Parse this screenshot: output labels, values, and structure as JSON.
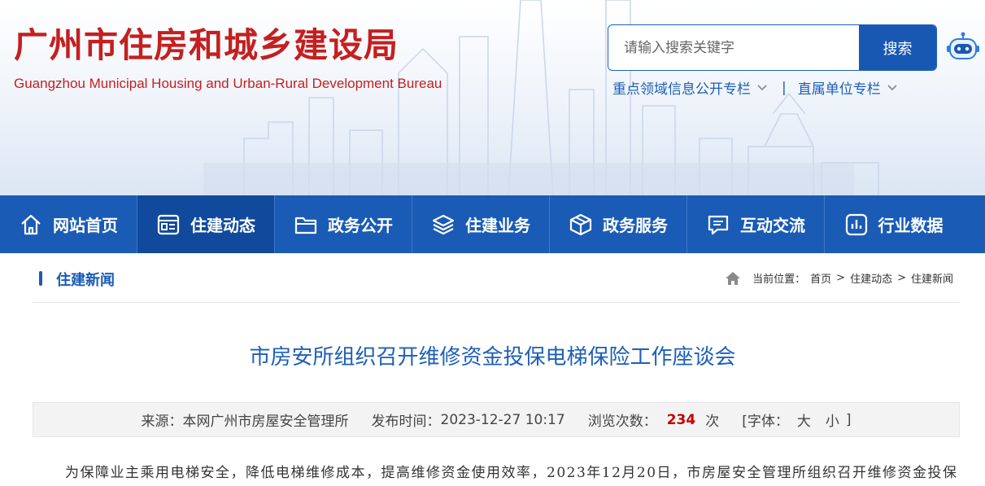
{
  "header": {
    "title_cn": "广州市住房和城乡建设局",
    "title_en": "Guangzhou Municipal Housing and Urban-Rural Development Bureau",
    "search_placeholder": "请输入搜索关键字",
    "search_button": "搜索",
    "quick_links": [
      {
        "label": "重点领域信息公开专栏"
      },
      {
        "label": "直属单位专栏"
      }
    ],
    "quick_sep": "|"
  },
  "nav": {
    "items": [
      {
        "label": "网站首页",
        "icon": "home-icon"
      },
      {
        "label": "住建动态",
        "icon": "news-icon",
        "active": true
      },
      {
        "label": "政务公开",
        "icon": "folder-icon"
      },
      {
        "label": "住建业务",
        "icon": "layers-icon"
      },
      {
        "label": "政务服务",
        "icon": "box-icon"
      },
      {
        "label": "互动交流",
        "icon": "chat-icon"
      },
      {
        "label": "行业数据",
        "icon": "chart-icon"
      }
    ]
  },
  "section": {
    "title": "住建新闻",
    "breadcrumb_label": "当前位置：",
    "crumbs": [
      "首页",
      "住建动态",
      "住建新闻"
    ],
    "crumb_sep": ">"
  },
  "article": {
    "title": "市房安所组织召开维修资金投保电梯保险工作座谈会",
    "source_label": "来源：",
    "source": "本网广州市房屋安全管理所",
    "time_label": "发布时间：",
    "time": "2023-12-27 10:17",
    "views_label": "浏览次数：",
    "views": "234",
    "views_unit": "次",
    "font_label": "[字体：",
    "font_large": "大",
    "font_small": "小",
    "font_close": "]",
    "body_first_line": "为保障业主乘用电梯安全，降低电梯维修成本，提高维修资金使用效率，2023年12月20日，市房屋安全管理所组织召开维修资金投保"
  },
  "colors": {
    "brand_red": "#c51f1f",
    "brand_blue": "#1a5bb5",
    "nav_active": "#114a9c",
    "views_red": "#c40000"
  }
}
